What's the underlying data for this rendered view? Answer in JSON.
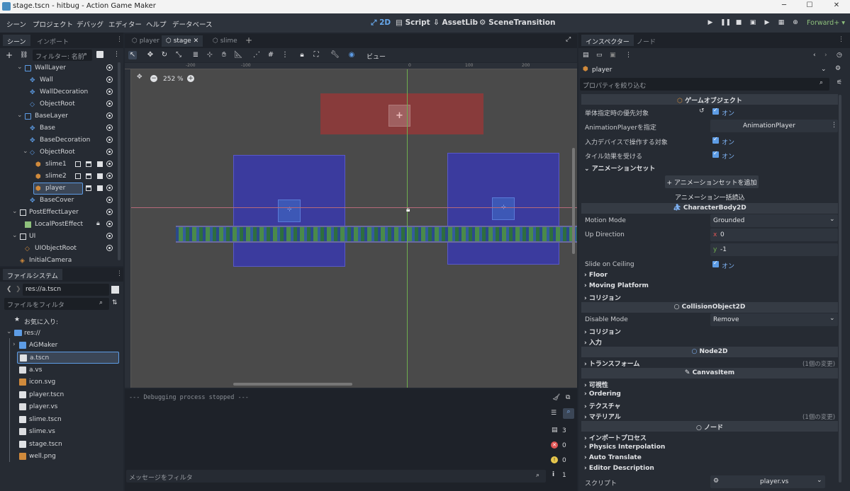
{
  "window": {
    "title": "stage.tscn - hitbug - Action Game Maker"
  },
  "menubar": {
    "items": [
      "シーン",
      "プロジェクト",
      "デバッグ",
      "エディター",
      "ヘルプ",
      "データベース"
    ],
    "workspaces": [
      "2D",
      "Script",
      "AssetLib",
      "SceneTransition"
    ],
    "renderer": "Forward+"
  },
  "scene_panel": {
    "tabs": [
      "シーン",
      "インポート"
    ],
    "filter_placeholder": "フィルター: 名前",
    "nodes": [
      {
        "label": "WallLayer"
      },
      {
        "label": "Wall"
      },
      {
        "label": "WallDecoration"
      },
      {
        "label": "ObjectRoot"
      },
      {
        "label": "BaseLayer"
      },
      {
        "label": "Base"
      },
      {
        "label": "BaseDecoration"
      },
      {
        "label": "ObjectRoot"
      },
      {
        "label": "slime1"
      },
      {
        "label": "slime2"
      },
      {
        "label": "player"
      },
      {
        "label": "BaseCover"
      },
      {
        "label": "PostEffectLayer"
      },
      {
        "label": "LocalPostEffect"
      },
      {
        "label": "UI"
      },
      {
        "label": "UIObjectRoot"
      },
      {
        "label": "InitialCamera"
      }
    ]
  },
  "filesystem": {
    "title": "ファイルシステム",
    "path": "res://a.tscn",
    "filter_placeholder": "ファイルをフィルタ",
    "favorites": "お気に入り:",
    "root": "res://",
    "items": [
      {
        "name": "AGMaker"
      },
      {
        "name": "a.tscn"
      },
      {
        "name": "a.vs"
      },
      {
        "name": "icon.svg"
      },
      {
        "name": "player.tscn"
      },
      {
        "name": "player.vs"
      },
      {
        "name": "slime.tscn"
      },
      {
        "name": "slime.vs"
      },
      {
        "name": "stage.tscn"
      },
      {
        "name": "well.png"
      }
    ]
  },
  "editor": {
    "tabs": [
      "player",
      "stage",
      "slime"
    ],
    "view_label": "ビュー",
    "zoom": "252 %",
    "ruler_labels": [
      "-200",
      "-100",
      "0",
      "100",
      "200"
    ],
    "debug_text": "--- Debugging process stopped ---",
    "message_filter_placeholder": "メッセージをフィルタ",
    "counts": {
      "total": "3",
      "errors": "0",
      "warnings": "0",
      "info": "1"
    }
  },
  "inspector": {
    "tabs": [
      "インスペクター",
      "ノード"
    ],
    "node_name": "player",
    "filter_placeholder": "プロパティを絞り込む",
    "section_gameobject": "ゲームオブジェクト",
    "rows": {
      "priority": "単体指定時の優先対象",
      "anim_player_label": "AnimationPlayerを指定",
      "anim_player_value": "AnimationPlayer",
      "input_device": "入力デバイスで操作する対象",
      "tile_effect": "タイル効果を受ける",
      "on": "オン"
    },
    "animset_category": "アニメーションセット",
    "add_animset": "アニメーションセットを追加",
    "bulk_load": "アニメーション一括読込",
    "section_cb2d": "CharacterBody2D",
    "motion_mode_label": "Motion Mode",
    "motion_mode_value": "Grounded",
    "up_direction_label": "Up Direction",
    "up_x": "0",
    "up_y": "-1",
    "slide_on_ceiling": "Slide on Ceiling",
    "cats1": [
      "Floor",
      "Moving Platform",
      "コリジョン"
    ],
    "section_co2d": "CollisionObject2D",
    "disable_mode_label": "Disable Mode",
    "disable_mode_value": "Remove",
    "cats2": [
      "コリジョン",
      "入力"
    ],
    "section_node2d": "Node2D",
    "transform": "トランスフォーム",
    "changed": "(1個の変更)",
    "section_canvas": "CanvasItem",
    "cats3": [
      "可視性",
      "Ordering",
      "テクスチャ",
      "マテリアル"
    ],
    "section_node": "ノード",
    "cats4": [
      "インポートプロセス",
      "Physics Interpolation",
      "Auto Translate",
      "Editor Description"
    ],
    "script_label": "スクリプト",
    "script_value": "player.vs"
  }
}
